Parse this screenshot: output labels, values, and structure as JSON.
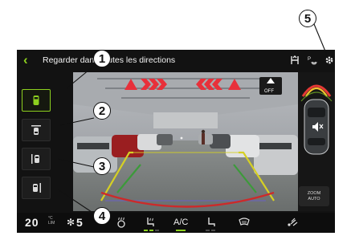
{
  "header": {
    "back_icon": "chevron-left-icon",
    "title": "Regarder dans toutes les directions",
    "icons": [
      "tow-hitch-icon",
      "parking-sensor-icon",
      "settings-gear-icon"
    ]
  },
  "views": [
    {
      "id": "front",
      "icon": "car-front-view-icon",
      "selected": true
    },
    {
      "id": "rear",
      "icon": "car-rear-view-icon",
      "selected": false
    },
    {
      "id": "left",
      "icon": "car-left-side-view-icon",
      "selected": false
    },
    {
      "id": "right",
      "icon": "car-right-side-view-icon",
      "selected": false
    }
  ],
  "camera": {
    "off_button_label": "OFF",
    "warning_icon": "cross-traffic-warning-icon",
    "guideline_colors": {
      "far": "#d6d024",
      "mid": "#3c9a3a",
      "near": "#cc2a2a",
      "center": "#6a5fd0"
    },
    "arrow_color": "#e8303a"
  },
  "right_panel": {
    "distance_arc_colors": [
      "#e53935",
      "#f2c230",
      "#7fbf2a"
    ],
    "mute_icon": "speaker-mute-icon",
    "zoom_label_line1": "ZOOM",
    "zoom_label_line2": "AUTO"
  },
  "climate": {
    "temperature": "20",
    "temperature_unit": "°C",
    "temperature_mode": "LIM",
    "fan_speed": "5",
    "ac_label": "A/C",
    "icons": [
      "steering-heat-icon",
      "seat-heat-icon",
      "ac-icon",
      "seat-ventilation-icon",
      "windshield-defrost-icon",
      "fan-direction-icon"
    ],
    "active_color": "#8ccf1f"
  },
  "callouts": [
    "1",
    "2",
    "3",
    "4",
    "5"
  ]
}
